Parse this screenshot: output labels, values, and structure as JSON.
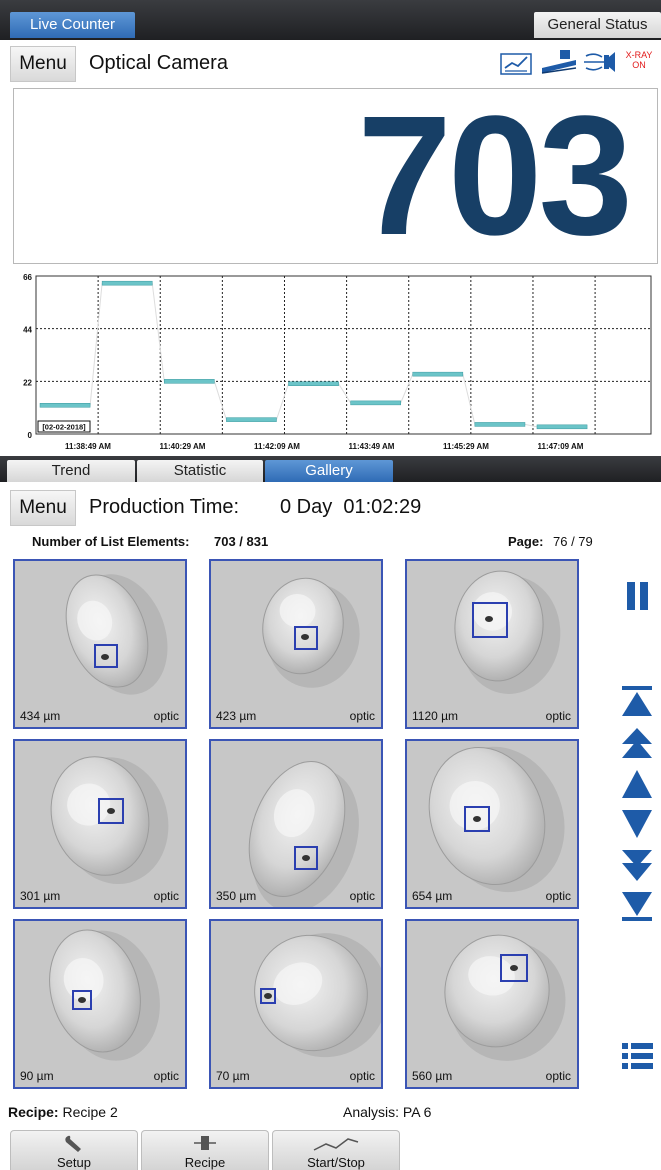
{
  "top_tabs": {
    "live_counter": "Live Counter",
    "general_status": "General Status"
  },
  "header": {
    "menu_label": "Menu",
    "title": "Optical Camera",
    "status_icons": [
      "chart-report-icon",
      "conveyor-icon",
      "air-valve-icon",
      "xray-status-icon"
    ],
    "xray_text_line1": "X-RAY",
    "xray_text_line2": "ON"
  },
  "counter": {
    "value": "703",
    "color": "#173f66"
  },
  "chart_data": {
    "type": "line",
    "style": "step-segments",
    "date_label": "[02-02-2018]",
    "y_ticks": [
      "66",
      "44",
      "22",
      "0"
    ],
    "ylim": [
      0,
      66
    ],
    "x_tick_labels": [
      "11:38:49 AM",
      "11:40:29 AM",
      "11:42:09 AM",
      "11:43:49 AM",
      "11:45:29 AM",
      "11:47:09 AM"
    ],
    "segments": [
      {
        "value": 12
      },
      {
        "value": 63
      },
      {
        "value": 22
      },
      {
        "value": 6
      },
      {
        "value": 21
      },
      {
        "value": 13
      },
      {
        "value": 25
      },
      {
        "value": 4
      },
      {
        "value": 3
      }
    ],
    "grid": true,
    "bar_color": "#6bc4c8"
  },
  "view_tabs": [
    {
      "label": "Trend",
      "active": false
    },
    {
      "label": "Statistic",
      "active": false
    },
    {
      "label": "Gallery",
      "active": true
    }
  ],
  "production": {
    "menu_label": "Menu",
    "label": "Production Time:",
    "value": "0 Day  01:02:29"
  },
  "gallery": {
    "list_label": "Number of List Elements:",
    "list_value": "703 / 831",
    "page_label": "Page:",
    "page_value": "76 / 79",
    "tiles": [
      {
        "size": "434 µm",
        "kind": "optic"
      },
      {
        "size": "423 µm",
        "kind": "optic"
      },
      {
        "size": "1120 µm",
        "kind": "optic"
      },
      {
        "size": "301 µm",
        "kind": "optic"
      },
      {
        "size": "350 µm",
        "kind": "optic"
      },
      {
        "size": "654 µm",
        "kind": "optic"
      },
      {
        "size": "90 µm",
        "kind": "optic"
      },
      {
        "size": "70 µm",
        "kind": "optic"
      },
      {
        "size": "560 µm",
        "kind": "optic"
      }
    ]
  },
  "side_controls": [
    "pause-icon",
    "first-page-icon",
    "page-up-fast-icon",
    "page-up-icon",
    "page-down-icon",
    "page-down-fast-icon",
    "last-page-icon",
    "list-view-icon"
  ],
  "footer": {
    "recipe_label": "Recipe:",
    "recipe_value": "Recipe 2",
    "analysis_label": "Analysis:",
    "analysis_value": "PA 6"
  },
  "bottom_buttons": [
    {
      "label": "Setup",
      "icon": "wrench-icon"
    },
    {
      "label": "Recipe",
      "icon": "recipe-icon"
    },
    {
      "label": "Start/Stop",
      "icon": "start-stop-icon"
    }
  ],
  "colors": {
    "accent_blue": "#2f6bb5",
    "frame_blue": "#3b55b5",
    "control_blue": "#1e5ba8"
  }
}
